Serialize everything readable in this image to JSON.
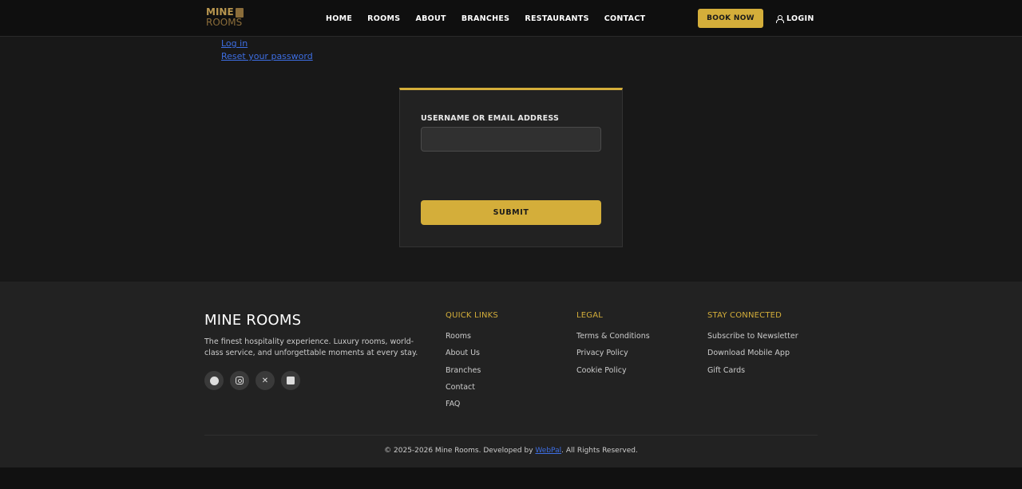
{
  "header": {
    "logo_line1": "MINE",
    "logo_line2": "ROOMS",
    "nav": [
      "HOME",
      "ROOMS",
      "ABOUT",
      "BRANCHES",
      "RESTAURANTS",
      "CONTACT"
    ],
    "book_now": "BOOK NOW",
    "login": "LOGIN"
  },
  "top_links": [
    "Log in",
    "Reset your password"
  ],
  "form": {
    "label": "USERNAME OR EMAIL ADDRESS",
    "input_value": "",
    "submit": "SUBMIT"
  },
  "footer": {
    "brand": "MINE ROOMS",
    "description": "The finest hospitality experience. Luxury rooms, world-class service, and unforgettable moments at every stay.",
    "socials": [
      "facebook-icon",
      "instagram-icon",
      "x-icon",
      "linkedin-icon"
    ],
    "quick_links": {
      "title": "QUICK LINKS",
      "items": [
        "Rooms",
        "About Us",
        "Branches",
        "Contact",
        "FAQ"
      ]
    },
    "legal": {
      "title": "LEGAL",
      "items": [
        "Terms & Conditions",
        "Privacy Policy",
        "Cookie Policy"
      ]
    },
    "stay_connected": {
      "title": "STAY CONNECTED",
      "items": [
        "Subscribe to Newsletter",
        "Download Mobile App",
        "Gift Cards"
      ]
    },
    "copyright_prefix": "© 2025-2026 Mine Rooms. Developed by",
    "developer": "WebPal",
    "copyright_suffix": ". All Rights Reserved."
  },
  "colors": {
    "accent": "#d4ae3a",
    "link": "#3d6ee3",
    "background": "#181818"
  }
}
